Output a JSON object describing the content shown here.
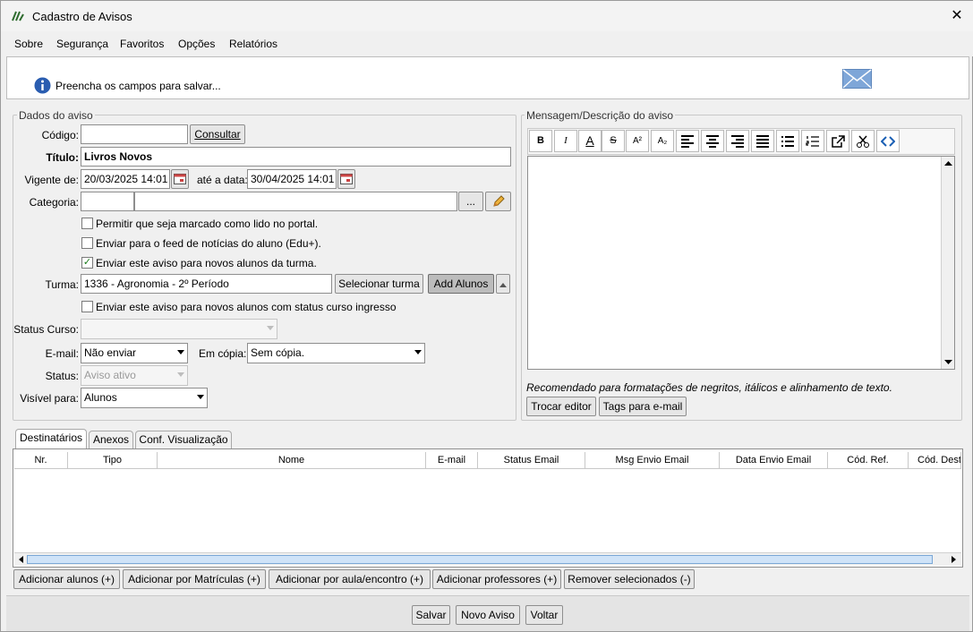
{
  "window": {
    "title": "Cadastro de Avisos",
    "close_glyph": "✕"
  },
  "menu": [
    "Sobre",
    "Segurança",
    "Favoritos",
    "Opções",
    "Relatórios"
  ],
  "info": {
    "message": "Preencha os campos para salvar...",
    "icon": "info-icon"
  },
  "dados": {
    "legend": "Dados do aviso",
    "codigo_label": "Código:",
    "codigo_value": "",
    "consultar_label": "Consultar",
    "titulo_label": "Título:",
    "titulo_value": "Livros Novos",
    "vigente_label": "Vigente de:",
    "vigente_value": "20/03/2025 14:01",
    "ate_label": "até a data:",
    "ate_value": "30/04/2025 14:01",
    "categoria_label": "Categoria:",
    "categoria_code": "",
    "categoria_name": "",
    "categoria_browse": "...",
    "checks": [
      {
        "label": "Permitir que seja marcado como lido no portal.",
        "checked": false
      },
      {
        "label": "Enviar para o feed de notícias do aluno (Edu+).",
        "checked": false
      },
      {
        "label": "Enviar este aviso para novos alunos da turma.",
        "checked": true
      }
    ],
    "turma_label": "Turma:",
    "turma_value": "1336 - Agronomia - 2º Período",
    "selecionar_turma": "Selecionar turma",
    "add_alunos": "Add Alunos",
    "check_ingresso": {
      "label": "Enviar este aviso para novos alunos com status curso ingresso",
      "checked": false
    },
    "status_curso_label": "Status Curso:",
    "status_curso_value": "",
    "email_label": "E-mail:",
    "email_value": "Não enviar",
    "emcopia_label": "Em cópia:",
    "emcopia_value": "Sem cópia.",
    "status_label": "Status:",
    "status_value": "Aviso ativo",
    "visivel_label": "Visível para:",
    "visivel_value": "Alunos"
  },
  "mensagem": {
    "legend": "Mensagem/Descrição do aviso",
    "toolbar": [
      "B",
      "I",
      "A",
      "S",
      "A²",
      "A₂",
      "align-left",
      "align-center",
      "align-right",
      "justify",
      "bullets",
      "numbered",
      "open-external",
      "cut",
      "source-code"
    ],
    "hint": "Recomendado para formatações de negritos, itálicos e alinhamento de texto.",
    "trocar_editor": "Trocar editor",
    "tags_email": "Tags para e-mail"
  },
  "tabs": [
    "Destinatários",
    "Anexos",
    "Conf. Visualização"
  ],
  "table": {
    "columns": [
      "Nr.",
      "Tipo",
      "Nome",
      "E-mail",
      "Status Email",
      "Msg Envio Email",
      "Data Envio Email",
      "Cód. Ref.",
      "Cód. Dest"
    ],
    "rows": []
  },
  "bottom_buttons": [
    "Adicionar alunos (+)",
    "Adicionar por Matrículas (+)",
    "Adicionar por aula/encontro (+)",
    "Adicionar professores (+)",
    "Remover selecionados (-)"
  ],
  "footer": {
    "salvar": "Salvar",
    "novo_aviso": "Novo Aviso",
    "voltar": "Voltar"
  },
  "colors": {
    "accent_yellow": "#f4e08c",
    "check_green": "#1a7a1a",
    "info_blue": "#2a5db0"
  }
}
